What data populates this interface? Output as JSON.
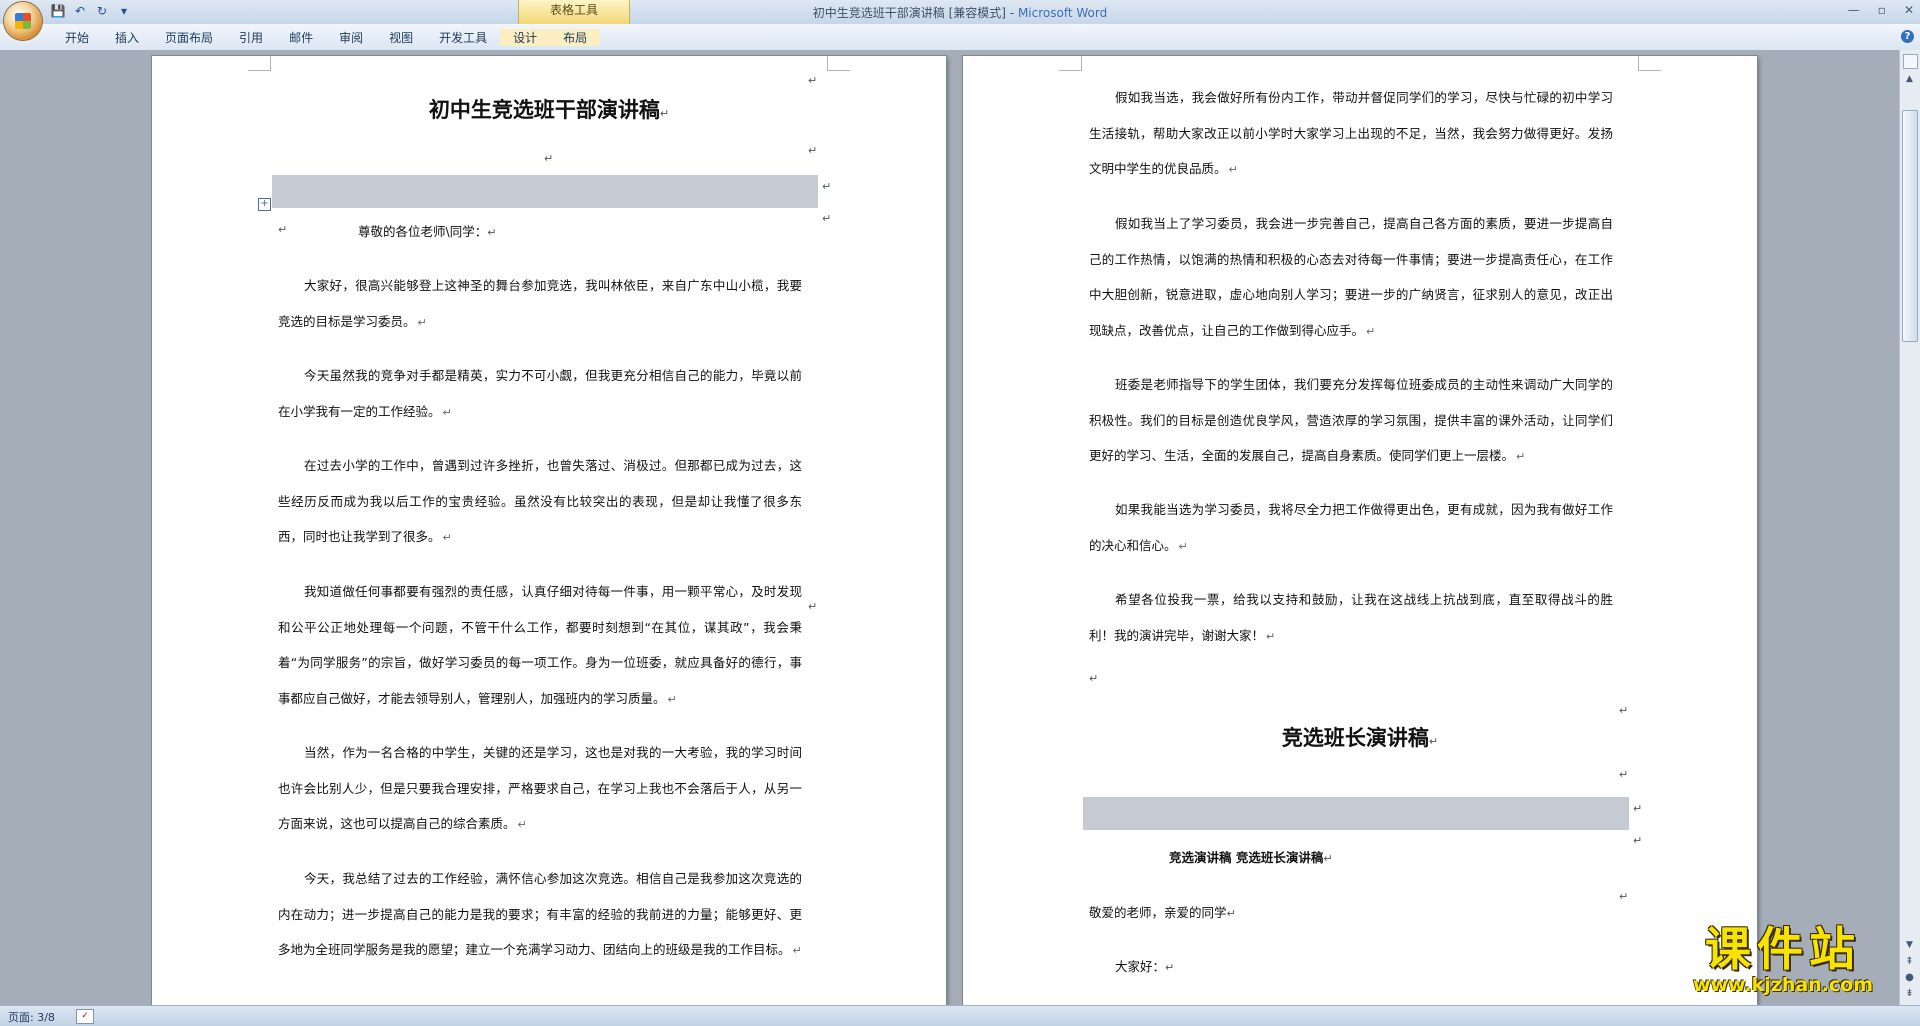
{
  "window": {
    "title": "初中生竞选班干部演讲稿 [兼容模式]",
    "separator": " - ",
    "app": "Microsoft Word",
    "context_tools": "表格工具"
  },
  "ribbon": {
    "tabs": [
      "开始",
      "插入",
      "页面布局",
      "引用",
      "邮件",
      "审阅",
      "视图",
      "开发工具",
      "设计",
      "布局"
    ]
  },
  "left_page": {
    "title": "初中生竞选班干部演讲稿",
    "salutation": "尊敬的各位老师\\同学：",
    "paragraphs": [
      "大家好，很高兴能够登上这神圣的舞台参加竞选，我叫林依臣，来自广东中山小榄，我要竞选的目标是学习委员。",
      "今天虽然我的竞争对手都是精英，实力不可小觑，但我更充分相信自己的能力，毕竟以前在小学我有一定的工作经验。",
      "在过去小学的工作中，曾遇到过许多挫折，也曾失落过、消极过。但那都已成为过去，这些经历反而成为我以后工作的宝贵经验。虽然没有比较突出的表现，但是却让我懂了很多东西，同时也让我学到了很多。",
      "我知道做任何事都要有强烈的责任感，认真仔细对待每一件事，用一颗平常心，及时发现和公平公正地处理每一个问题，不管干什么工作，都要时刻想到“在其位，谋其政”，我会秉着“为同学服务”的宗旨，做好学习委员的每一项工作。身为一位班委，就应具备好的德行，事事都应自己做好，才能去领导别人，管理别人，加强班内的学习质量。",
      "当然，作为一名合格的中学生，关键的还是学习，这也是对我的一大考验，我的学习时间也许会比别人少，但是只要我合理安排，严格要求自己，在学习上我也不会落后于人，从另一方面来说，这也可以提高自己的综合素质。",
      "今天，我总结了过去的工作经验，满怀信心参加这次竞选。相信自己是我参加这次竞选的内在动力；进一步提高自己的能力是我的要求；有丰富的经验的我前进的力量；能够更好、更多地为全班同学服务是我的愿望；建立一个充满学习动力、团结向上的班级是我的工作目标。"
    ]
  },
  "right_page": {
    "paragraphs": [
      "假如我当选，我会做好所有份内工作，带动并督促同学们的学习，尽快与忙碌的初中学习生活接轨，帮助大家改正以前小学时大家学习上出现的不足，当然，我会努力做得更好。发扬文明中学生的优良品质。",
      "假如我当上了学习委员，我会进一步完善自己，提高自己各方面的素质，要进一步提高自己的工作热情，以饱满的热情和积极的心态去对待每一件事情；要进一步提高责任心，在工作中大胆创新，锐意进取，虚心地向别人学习；要进一步的广纳贤言，征求别人的意见，改正出现缺点，改善优点，让自己的工作做到得心应手。",
      "班委是老师指导下的学生团体，我们要充分发挥每位班委成员的主动性来调动广大同学的积极性。我们的目标是创造优良学风，营造浓厚的学习氛围，提供丰富的课外活动，让同学们更好的学习、生活，全面的发展自己，提高自身素质。使同学们更上一层楼。",
      "如果我能当选为学习委员，我将尽全力把工作做得更出色，更有成就，因为我有做好工作的决心和信心。",
      "希望各位投我一票，给我以支持和鼓励，让我在这战线上抗战到底，直至取得战斗的胜利！我的演讲完毕，谢谢大家！"
    ],
    "title2": "竞选班长演讲稿",
    "subheading": "竞选演讲稿 竞选班长演讲稿",
    "greeting": "敬爱的老师，亲爱的同学",
    "dajiahao": "大家好："
  },
  "status": {
    "page": "页面: 3/8"
  },
  "watermark": {
    "main": "课件站",
    "url": "www.kjzhan.com"
  },
  "colors": {
    "accent": "#2b579a",
    "context_tab": "#f2d777",
    "watermark": "#f6e400"
  }
}
